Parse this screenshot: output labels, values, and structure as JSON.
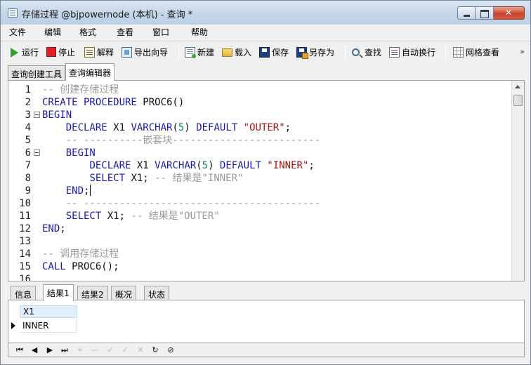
{
  "window": {
    "title": "存储过程 @bjpowernode (本机) - 查询 *",
    "controls": {
      "minimize": "minimize",
      "maximize": "maximize",
      "close": "✕"
    }
  },
  "menu": [
    "文件",
    "编辑",
    "格式",
    "查看",
    "窗口",
    "帮助"
  ],
  "toolbar": {
    "run": "运行",
    "stop": "停止",
    "explain": "解释",
    "export_wizard": "导出向导",
    "new": "新建",
    "load": "载入",
    "save": "保存",
    "save_as": "另存为",
    "find": "查找",
    "word_wrap": "自动换行",
    "grid_view": "网格查看",
    "overflow": "»"
  },
  "tabs": [
    "查询创建工具",
    "查询编辑器"
  ],
  "active_tab": "查询编辑器",
  "editor": {
    "lines": [
      {
        "num": "1",
        "fold": false,
        "tokens": [
          {
            "t": "cm",
            "v": "-- 创建存储过程"
          }
        ]
      },
      {
        "num": "2",
        "fold": false,
        "tokens": [
          {
            "t": "kw",
            "v": "CREATE PROCEDURE"
          },
          {
            "t": "plain",
            "v": " PROC6()"
          }
        ]
      },
      {
        "num": "3",
        "fold": true,
        "tokens": [
          {
            "t": "kw",
            "v": "BEGIN"
          }
        ]
      },
      {
        "num": "4",
        "fold": false,
        "tokens": [
          {
            "t": "plain",
            "v": "    "
          },
          {
            "t": "kw",
            "v": "DECLARE"
          },
          {
            "t": "plain",
            "v": " X1 "
          },
          {
            "t": "kw",
            "v": "VARCHAR"
          },
          {
            "t": "plain",
            "v": "("
          },
          {
            "t": "num",
            "v": "5"
          },
          {
            "t": "plain",
            "v": ") "
          },
          {
            "t": "kw",
            "v": "DEFAULT"
          },
          {
            "t": "plain",
            "v": " "
          },
          {
            "t": "str",
            "v": "\"OUTER\""
          },
          {
            "t": "plain",
            "v": ";"
          }
        ]
      },
      {
        "num": "5",
        "fold": false,
        "tokens": [
          {
            "t": "plain",
            "v": "    "
          },
          {
            "t": "cm",
            "v": "-- ----------嵌套块-------------------------"
          }
        ]
      },
      {
        "num": "6",
        "fold": true,
        "tokens": [
          {
            "t": "plain",
            "v": "    "
          },
          {
            "t": "kw",
            "v": "BEGIN"
          }
        ]
      },
      {
        "num": "7",
        "fold": false,
        "tokens": [
          {
            "t": "plain",
            "v": "        "
          },
          {
            "t": "kw",
            "v": "DECLARE"
          },
          {
            "t": "plain",
            "v": " X1 "
          },
          {
            "t": "kw",
            "v": "VARCHAR"
          },
          {
            "t": "plain",
            "v": "("
          },
          {
            "t": "num",
            "v": "5"
          },
          {
            "t": "plain",
            "v": ") "
          },
          {
            "t": "kw",
            "v": "DEFAULT"
          },
          {
            "t": "plain",
            "v": " "
          },
          {
            "t": "str",
            "v": "\"INNER\""
          },
          {
            "t": "plain",
            "v": ";"
          }
        ]
      },
      {
        "num": "8",
        "fold": false,
        "tokens": [
          {
            "t": "plain",
            "v": "        "
          },
          {
            "t": "kw",
            "v": "SELECT"
          },
          {
            "t": "plain",
            "v": " X1; "
          },
          {
            "t": "cm",
            "v": "-- 结果是\"INNER\""
          }
        ]
      },
      {
        "num": "9",
        "fold": false,
        "caret": true,
        "tokens": [
          {
            "t": "plain",
            "v": "    "
          },
          {
            "t": "kw",
            "v": "END"
          },
          {
            "t": "plain",
            "v": ";"
          }
        ]
      },
      {
        "num": "10",
        "fold": false,
        "tokens": [
          {
            "t": "plain",
            "v": "    "
          },
          {
            "t": "cm",
            "v": "-- ----------------------------------------"
          }
        ]
      },
      {
        "num": "11",
        "fold": false,
        "tokens": [
          {
            "t": "plain",
            "v": "    "
          },
          {
            "t": "kw",
            "v": "SELECT"
          },
          {
            "t": "plain",
            "v": " X1; "
          },
          {
            "t": "cm",
            "v": "-- 结果是\"OUTER\""
          }
        ]
      },
      {
        "num": "12",
        "fold": false,
        "tokens": [
          {
            "t": "kw",
            "v": "END"
          },
          {
            "t": "plain",
            "v": ";"
          }
        ]
      },
      {
        "num": "13",
        "fold": false,
        "tokens": []
      },
      {
        "num": "14",
        "fold": false,
        "tokens": [
          {
            "t": "cm",
            "v": "-- 调用存储过程"
          }
        ]
      },
      {
        "num": "15",
        "fold": false,
        "tokens": [
          {
            "t": "kw",
            "v": "CALL"
          },
          {
            "t": "plain",
            "v": " PROC6();"
          }
        ]
      },
      {
        "num": "16",
        "fold": false,
        "tokens": []
      }
    ]
  },
  "result_tabs": [
    "信息",
    "结果1",
    "结果2",
    "概况",
    "状态"
  ],
  "active_result_tab": "结果1",
  "result_grid": {
    "columns": [
      "X1"
    ],
    "rows": [
      [
        "INNER"
      ]
    ]
  },
  "navigator": [
    "⏮",
    "◀",
    "▶",
    "⏭",
    "+",
    "—",
    "✓",
    "✓",
    "✕",
    "↻",
    "⊘"
  ],
  "colors": {
    "keyword": "#1a1aa8",
    "comment": "#9a9a9a",
    "string": "#a31515",
    "number": "#098658",
    "selected_header": "#dfeffb"
  }
}
